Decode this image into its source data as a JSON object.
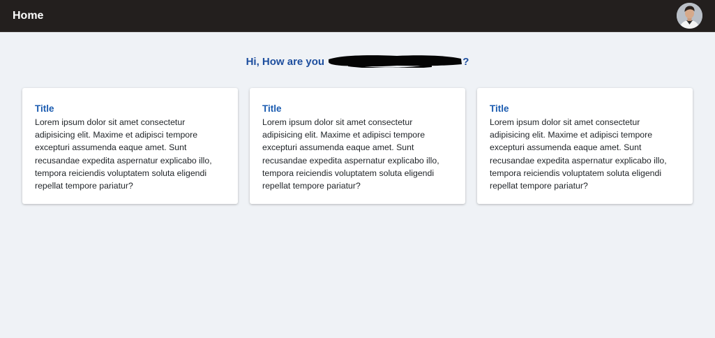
{
  "navbar": {
    "title": "Home",
    "avatar_icon": "user-avatar-photo"
  },
  "greeting": {
    "prefix": "Hi, How are you ",
    "suffix": "?"
  },
  "cards": [
    {
      "title": "Title",
      "body": "Lorem ipsum dolor sit amet consectetur adipisicing elit. Maxime et adipisci tempore excepturi assumenda eaque amet. Sunt recusandae expedita aspernatur explicabo illo, tempora reiciendis voluptatem soluta eligendi repellat tempore pariatur?"
    },
    {
      "title": "Title",
      "body": "Lorem ipsum dolor sit amet consectetur adipisicing elit. Maxime et adipisci tempore excepturi assumenda eaque amet. Sunt recusandae expedita aspernatur explicabo illo, tempora reiciendis voluptatem soluta eligendi repellat tempore pariatur?"
    },
    {
      "title": "Title",
      "body": "Lorem ipsum dolor sit amet consectetur adipisicing elit. Maxime et adipisci tempore excepturi assumenda eaque amet. Sunt recusandae expedita aspernatur explicabo illo, tempora reiciendis voluptatem soluta eligendi repellat tempore pariatur?"
    }
  ],
  "colors": {
    "navbar_bg": "#231f1e",
    "page_bg": "#eff2f6",
    "accent": "#1a5bb0",
    "greeting": "#1d4e9e"
  }
}
